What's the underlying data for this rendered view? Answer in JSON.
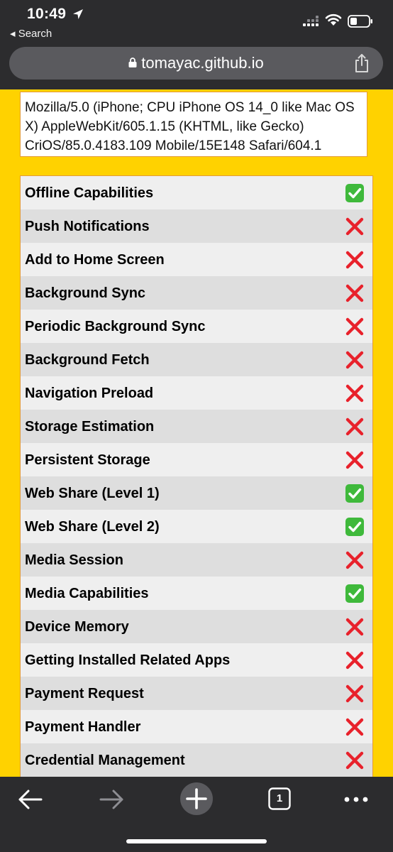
{
  "status_bar": {
    "time": "10:49",
    "back_label": "◂ Search"
  },
  "browser": {
    "url": "tomayac.github.io"
  },
  "user_agent": "Mozilla/5.0 (iPhone; CPU iPhone OS 14_0 like Mac OS X) AppleWebKit/605.1.15 (KHTML, like Gecko) CriOS/85.0.4183.109 Mobile/15E148 Safari/604.1",
  "features": [
    {
      "label": "Offline Capabilities",
      "supported": true
    },
    {
      "label": "Push Notifications",
      "supported": false
    },
    {
      "label": "Add to Home Screen",
      "supported": false
    },
    {
      "label": "Background Sync",
      "supported": false
    },
    {
      "label": "Periodic Background Sync",
      "supported": false
    },
    {
      "label": "Background Fetch",
      "supported": false
    },
    {
      "label": "Navigation Preload",
      "supported": false
    },
    {
      "label": "Storage Estimation",
      "supported": false
    },
    {
      "label": "Persistent Storage",
      "supported": false
    },
    {
      "label": "Web Share (Level 1)",
      "supported": true
    },
    {
      "label": "Web Share (Level 2)",
      "supported": true
    },
    {
      "label": "Media Session",
      "supported": false
    },
    {
      "label": "Media Capabilities",
      "supported": true
    },
    {
      "label": "Device Memory",
      "supported": false
    },
    {
      "label": "Getting Installed Related Apps",
      "supported": false
    },
    {
      "label": "Payment Request",
      "supported": false
    },
    {
      "label": "Payment Handler",
      "supported": false
    },
    {
      "label": "Credential Management",
      "supported": false
    }
  ],
  "toolbar": {
    "tab_count": "1"
  },
  "colors": {
    "page_background": "#ffd200",
    "supported": "#3fb93b",
    "unsupported": "#e8212b"
  }
}
